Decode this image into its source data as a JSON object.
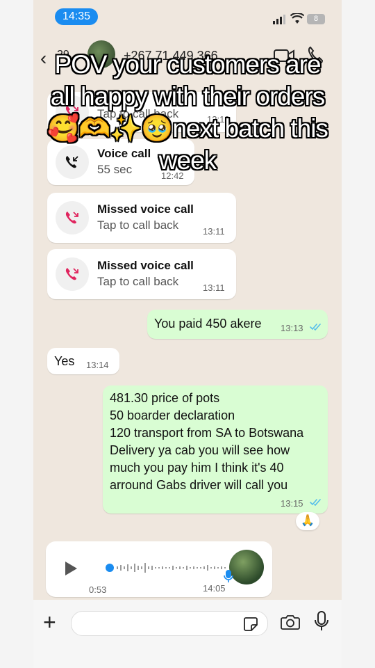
{
  "status": {
    "time": "14:35",
    "battery": "8"
  },
  "header": {
    "unread_count": "29",
    "contact": "+267 71 449 366"
  },
  "overlay": {
    "lines": [
      "POV your customers are",
      "all happy with their orders",
      "🥰🫶✨🥹next batch this",
      "week"
    ]
  },
  "calls": [
    {
      "title": "Missed voice call",
      "subtitle": "Tap to call back",
      "time": "12:12",
      "type": "missed"
    },
    {
      "title": "Voice call",
      "subtitle": "55 sec",
      "time": "12:42",
      "type": "incoming"
    },
    {
      "title": "Missed voice call",
      "subtitle": "Tap to call back",
      "time": "13:11",
      "type": "missed"
    },
    {
      "title": "Missed voice call",
      "subtitle": "Tap to call back",
      "time": "13:11",
      "type": "missed"
    }
  ],
  "messages": [
    {
      "text": "You paid 450 akere",
      "time": "13:13",
      "direction": "out"
    },
    {
      "text": "Yes",
      "time": "13:14",
      "direction": "in"
    },
    {
      "lines": [
        "481.30 price of pots",
        "50 boarder declaration",
        "120 transport from SA to Botswana",
        "Delivery ya cab you will see how",
        "much you pay him I think it's 40",
        "arround Gabs driver will call you"
      ],
      "time": "13:15",
      "direction": "out"
    }
  ],
  "reaction": "🙏",
  "voice_note": {
    "duration": "0:53",
    "time": "14:05"
  },
  "colors": {
    "accent": "#1a8cf0",
    "outgoing": "#d9fdd3",
    "missed": "#e0245e",
    "chat_bg": "#efe7de"
  }
}
